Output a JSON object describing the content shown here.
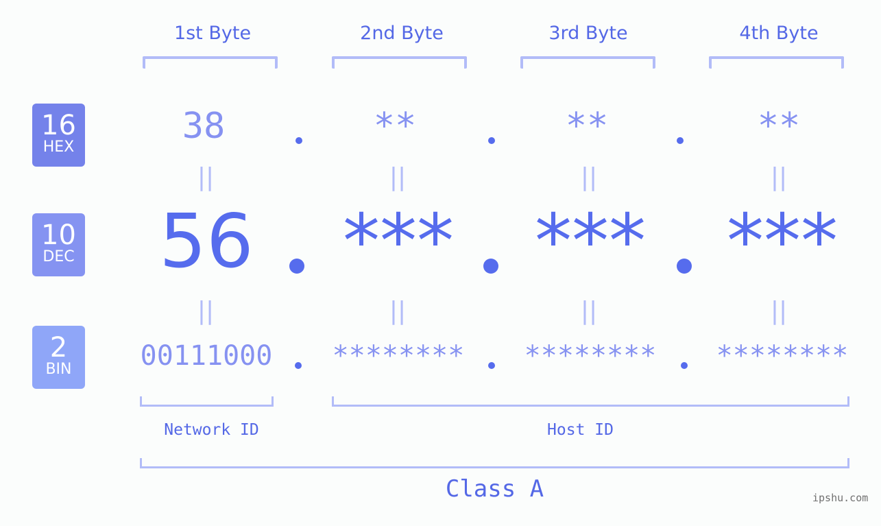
{
  "byte_headers": [
    "1st Byte",
    "2nd Byte",
    "3rd Byte",
    "4th Byte"
  ],
  "bases": [
    {
      "num": "16",
      "label": "HEX",
      "color": "#7482ea"
    },
    {
      "num": "10",
      "label": "DEC",
      "color": "#8593f1"
    },
    {
      "num": "2",
      "label": "BIN",
      "color": "#8fa6f8"
    }
  ],
  "hex": [
    "38",
    "**",
    "**",
    "**"
  ],
  "dec": [
    "56",
    "***",
    "***",
    "***"
  ],
  "bin": [
    "00111000",
    "********",
    "********",
    "********"
  ],
  "equals_symbol": "||",
  "network_id_label": "Network ID",
  "host_id_label": "Host ID",
  "class_label": "Class A",
  "watermark": "ipshu.com",
  "colors": {
    "accent": "#566ced",
    "light": "#8692f1",
    "bracket": "#b2bcf8",
    "background": "#fbfdfc"
  }
}
